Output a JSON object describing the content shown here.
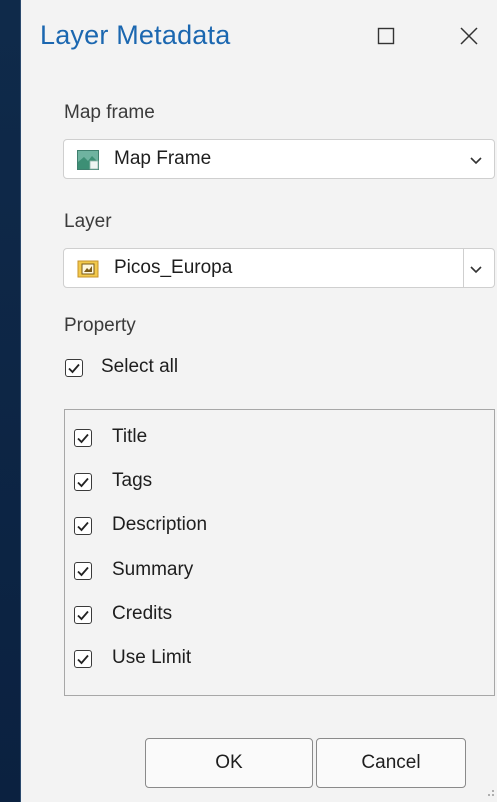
{
  "dialog": {
    "title": "Layer Metadata"
  },
  "map_frame": {
    "label": "Map frame",
    "value": "Map Frame"
  },
  "layer": {
    "label": "Layer",
    "value": "Picos_Europa"
  },
  "property": {
    "label": "Property",
    "select_all_label": "Select all",
    "select_all_checked": true,
    "items": [
      {
        "label": "Title",
        "checked": true
      },
      {
        "label": "Tags",
        "checked": true
      },
      {
        "label": "Description",
        "checked": true
      },
      {
        "label": "Summary",
        "checked": true
      },
      {
        "label": "Credits",
        "checked": true
      },
      {
        "label": "Use Limit",
        "checked": true
      }
    ]
  },
  "buttons": {
    "ok_label": "OK",
    "cancel_label": "Cancel"
  },
  "colors": {
    "title": "#1b67b0",
    "dialog_bg": "#f3f3f3",
    "backdrop": "#0f2a4a"
  },
  "icons": {
    "map_frame": "map-frame-icon",
    "layer": "raster-layer-icon",
    "maximize": "maximize-icon",
    "close": "close-icon",
    "dropdown": "chevron-down-icon",
    "check": "checkmark-icon"
  }
}
